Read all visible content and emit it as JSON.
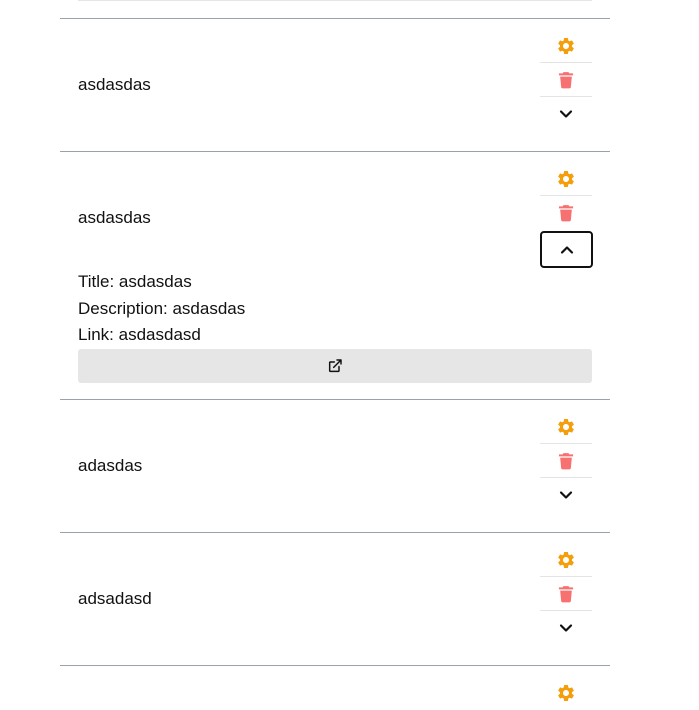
{
  "items": [
    {
      "title": "asdasdas"
    },
    {
      "title": "asdasdas",
      "details": {
        "title_line": "Title: asdasdas",
        "description_line": "Description: asdasdas",
        "link_line": "Link: asdasdasd"
      }
    },
    {
      "title": "adasdas"
    },
    {
      "title": "adsadasd"
    }
  ],
  "icons": {
    "settings": "gear-icon",
    "delete": "trash-icon",
    "expand": "chevron-down-icon",
    "collapse": "chevron-up-icon",
    "open_link": "external-link-icon"
  },
  "colors": {
    "settings": "#f59e0b",
    "delete": "#f87171",
    "divider": "#9aa3ab",
    "link_button_bg": "#e6e6e6"
  }
}
